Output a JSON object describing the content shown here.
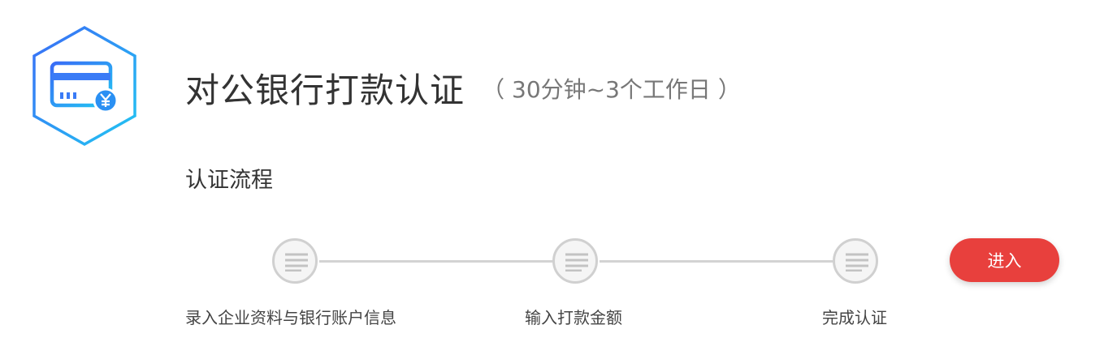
{
  "header": {
    "title": "对公银行打款认证",
    "subtitle": "（ 30分钟~3个工作日 ）",
    "logo_icon": "bank-card-yen-icon",
    "logo_colors": [
      "#3a7bf6",
      "#22c2f0"
    ]
  },
  "process": {
    "title": "认证流程",
    "steps": [
      {
        "label": "录入企业资料与银行账户信息",
        "icon": "document-lines-icon"
      },
      {
        "label": "输入打款金额",
        "icon": "document-lines-icon"
      },
      {
        "label": "完成认证",
        "icon": "document-lines-icon"
      }
    ]
  },
  "actions": {
    "enter_label": "进入",
    "enter_color": "#e8403d"
  }
}
